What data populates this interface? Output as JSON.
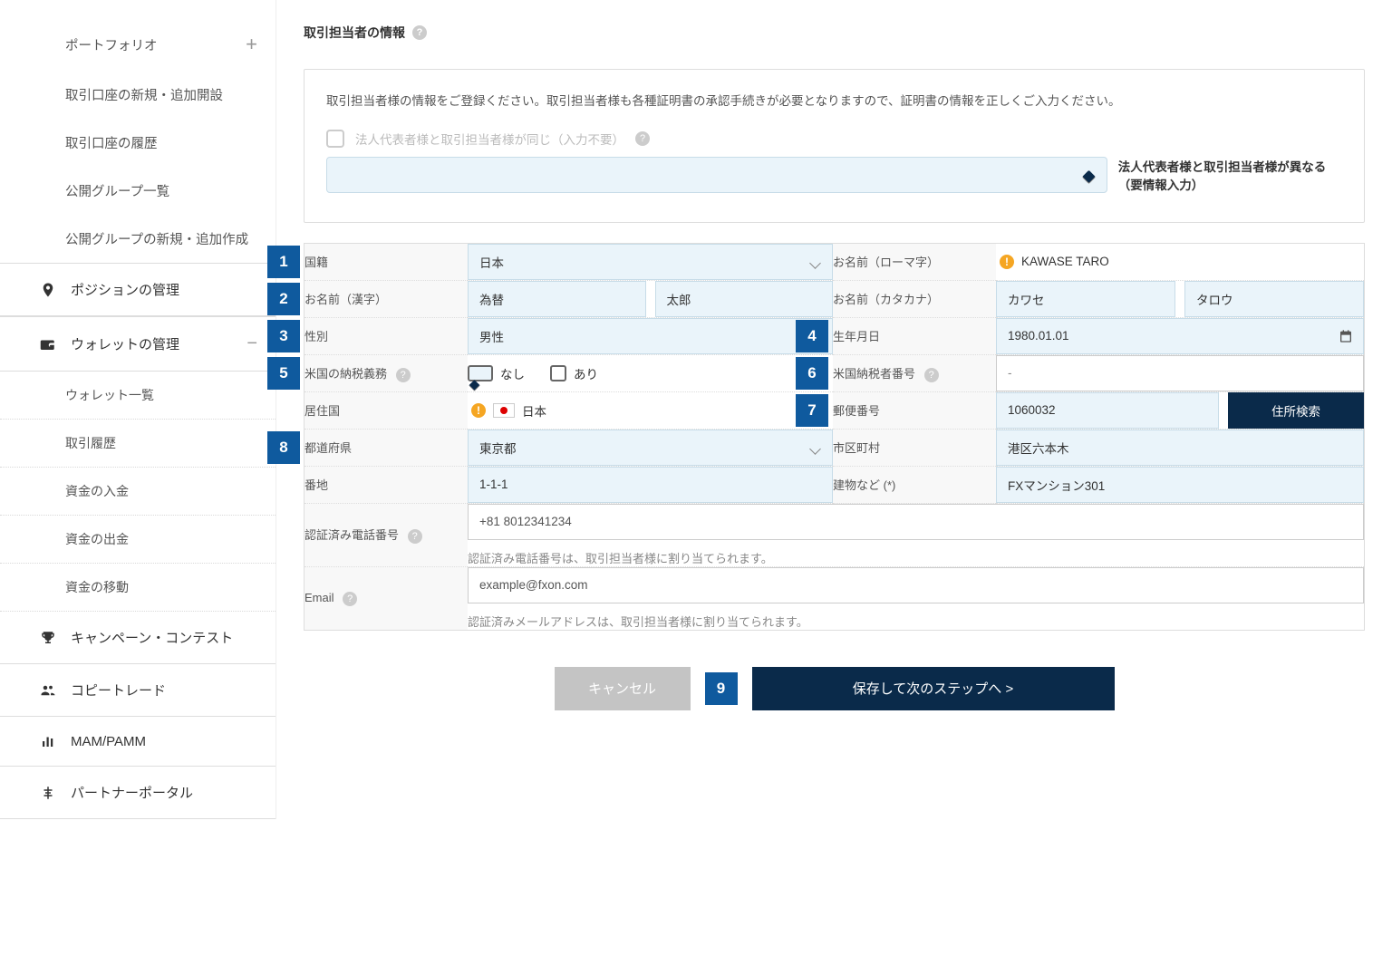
{
  "sidebar": {
    "portfolio": "ポートフォリオ",
    "items_top": [
      "取引口座の新規・追加開設",
      "取引口座の履歴",
      "公開グループ一覧",
      "公開グループの新規・追加作成"
    ],
    "position": "ポジションの管理",
    "wallet": "ウォレットの管理",
    "wallet_items": [
      "ウォレット一覧",
      "取引履歴",
      "資金の入金",
      "資金の出金",
      "資金の移動"
    ],
    "campaign": "キャンペーン・コンテスト",
    "copytrade": "コピートレード",
    "mam": "MAM/PAMM",
    "partner": "パートナーポータル"
  },
  "section_title": "取引担当者の情報",
  "info_text": "取引担当者様の情報をご登録ください。取引担当者様も各種証明書の承認手続きが必要となりますので、証明書の情報を正しくご入力ください。",
  "radios": {
    "same": "法人代表者様と取引担当者様が同じ（入力不要）",
    "diff": "法人代表者様と取引担当者様が異なる（要情報入力）"
  },
  "labels": {
    "nationality": "国籍",
    "name_roma": "お名前（ローマ字）",
    "name_kanji": "お名前（漢字）",
    "name_kana": "お名前（カタカナ）",
    "gender": "性別",
    "dob": "生年月日",
    "us_tax": "米国の納税義務",
    "us_tax_no": "米国納税者番号",
    "country": "居住国",
    "zip": "郵便番号",
    "prefecture": "都道府県",
    "city": "市区町村",
    "street": "番地",
    "building": "建物など (*)",
    "phone": "認証済み電話番号",
    "email": "Email"
  },
  "values": {
    "nationality": "日本",
    "name_roma": "KAWASE TARO",
    "name_kanji_sei": "為替",
    "name_kanji_mei": "太郎",
    "name_kana_sei": "カワセ",
    "name_kana_mei": "タロウ",
    "gender": "男性",
    "dob": "1980.01.01",
    "us_tax_none": "なし",
    "us_tax_yes": "あり",
    "us_tax_no_val": "-",
    "country": "日本",
    "zip": "1060032",
    "zip_search": "住所検索",
    "prefecture": "東京都",
    "city": "港区六本木",
    "street": "1-1-1",
    "building": "FXマンション301",
    "phone": "+81 8012341234",
    "phone_note": "認証済み電話番号は、取引担当者様に割り当てられます。",
    "email": "example@fxon.com",
    "email_note": "認証済みメールアドレスは、取引担当者様に割り当てられます。"
  },
  "buttons": {
    "cancel": "キャンセル",
    "next": "保存して次のステップへ >"
  },
  "badges": [
    "1",
    "2",
    "3",
    "4",
    "5",
    "6",
    "7",
    "8",
    "9"
  ]
}
